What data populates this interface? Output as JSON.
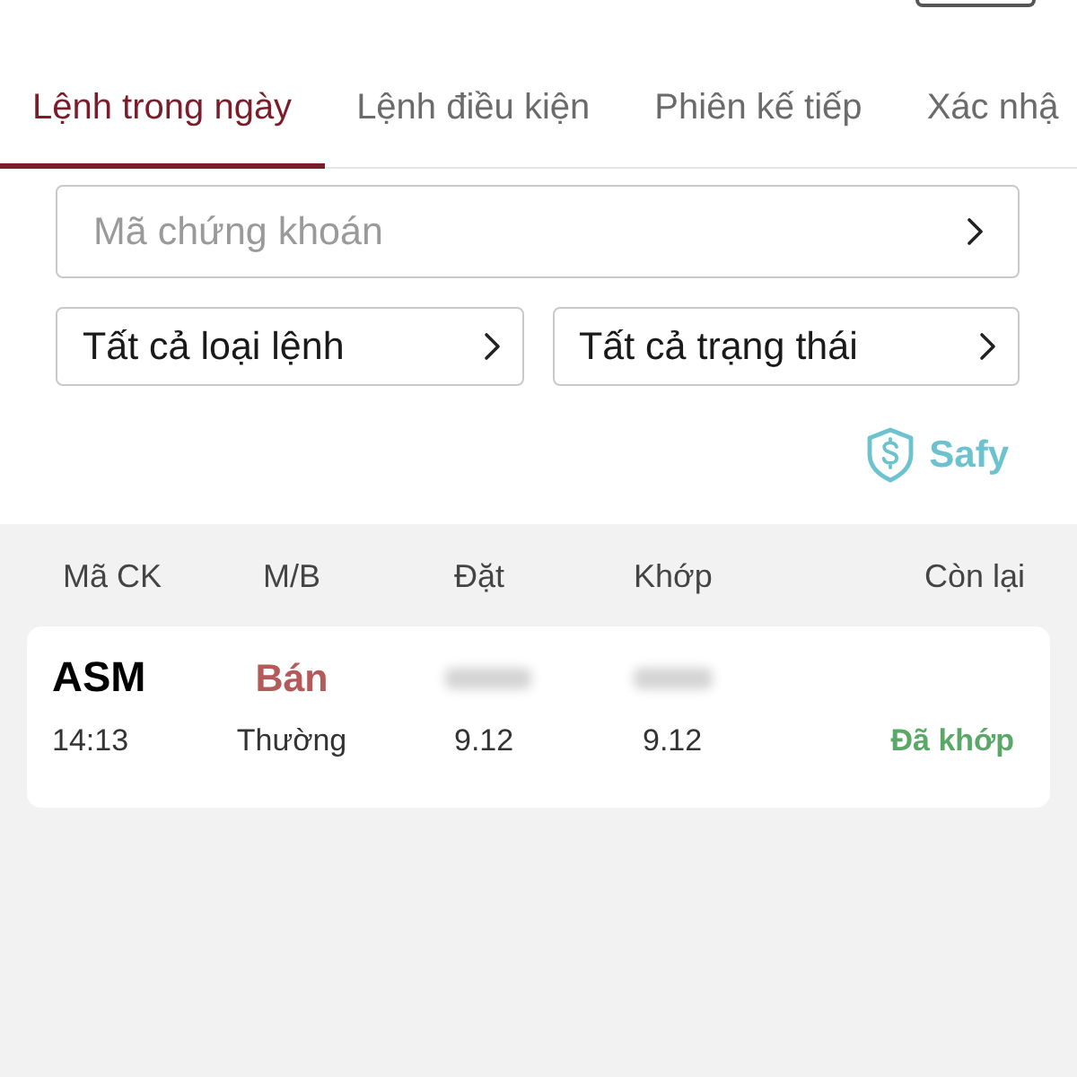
{
  "tabs": [
    {
      "label": "Lệnh trong ngày",
      "selected": true
    },
    {
      "label": "Lệnh điều kiện",
      "selected": false
    },
    {
      "label": "Phiên kế tiếp",
      "selected": false
    },
    {
      "label": "Xác nhậ",
      "selected": false
    }
  ],
  "search": {
    "placeholder": "Mã chứng khoán"
  },
  "filters": [
    {
      "label": "Tất cả loại lệnh"
    },
    {
      "label": "Tất cả trạng thái"
    }
  ],
  "safy": {
    "label": "Safy"
  },
  "orders": {
    "columns": [
      "Mã CK",
      "M/B",
      "Đặt",
      "Khớp",
      "Còn lại"
    ],
    "rows": [
      {
        "symbol": "ASM",
        "side": {
          "text": "Bán",
          "color": "#b45a5a"
        },
        "volume_blurred": true,
        "matched_volume_blurred": true,
        "time": "14:13",
        "order_type": "Thường",
        "price": "9.12",
        "matched_price": "9.12",
        "status": {
          "text": "Đã khớp",
          "color": "#5aa867"
        }
      }
    ]
  }
}
